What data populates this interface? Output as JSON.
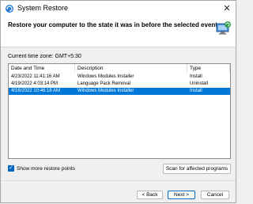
{
  "window": {
    "title": "System Restore",
    "close_symbol": "✕"
  },
  "header": {
    "heading": "Restore your computer to the state it was in before the selected event"
  },
  "timezone": "Current time zone: GMT+5:30",
  "table": {
    "columns": [
      "Date and Time",
      "Description",
      "Type"
    ],
    "rows": [
      {
        "date": "4/23/2022 11:41:16 AM",
        "description": "Windows Modules Installer",
        "type": "Install"
      },
      {
        "date": "4/19/2022 4:03:14 PM",
        "description": "Language Pack Removal",
        "type": "Uninstall"
      },
      {
        "date": "4/16/2022 10:46:18 AM",
        "description": "Windows Modules Installer",
        "type": "Install"
      }
    ],
    "selected_row": 3
  },
  "options": {
    "show_more_label": "Show more restore points",
    "show_more_checked": true,
    "check_symbol": "✓"
  },
  "buttons": {
    "scan": "Scan for affected programs",
    "back": "< Back",
    "next": "Next >",
    "cancel": "Cancel"
  },
  "icons": {
    "app": "system-restore-icon",
    "header": "computer-restore-icon",
    "close": "close-icon"
  },
  "colors": {
    "selection": "#0078d7",
    "accent": "#0067c0"
  }
}
